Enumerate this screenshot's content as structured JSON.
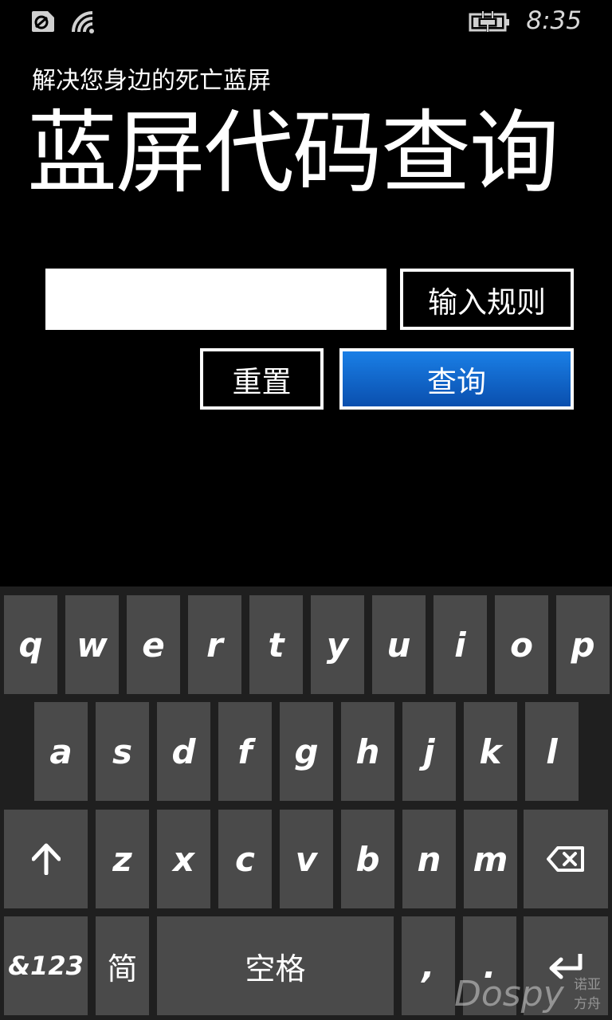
{
  "status_bar": {
    "time": "8:35",
    "icons": [
      "cellular-data-icon",
      "wifi-icon",
      "battery-charging-icon"
    ]
  },
  "header": {
    "subtitle": "解决您身边的死亡蓝屏",
    "title": "蓝屏代码查询"
  },
  "form": {
    "input_value": "",
    "rules_label": "输入规则",
    "reset_label": "重置",
    "query_label": "查询"
  },
  "keyboard": {
    "row1": [
      "q",
      "w",
      "e",
      "r",
      "t",
      "y",
      "u",
      "i",
      "o",
      "p"
    ],
    "row2": [
      "a",
      "s",
      "d",
      "f",
      "g",
      "h",
      "j",
      "k",
      "l"
    ],
    "row3": [
      "z",
      "x",
      "c",
      "v",
      "b",
      "n",
      "m"
    ],
    "shift_icon": "shift-up-arrow-icon",
    "backspace_icon": "backspace-icon",
    "enter_icon": "enter-icon",
    "symbols_label": "&123",
    "lang_label": "简",
    "space_label": "空格",
    "comma_label": ",",
    "period_label": "."
  },
  "watermark": {
    "main": "Dospy",
    "line1": "诺亚",
    "line2": "方舟"
  },
  "colors": {
    "background": "#000000",
    "accent": "#1a6fd8",
    "key": "#4a4a4a",
    "keyboard_bg": "#1f1f1f"
  }
}
